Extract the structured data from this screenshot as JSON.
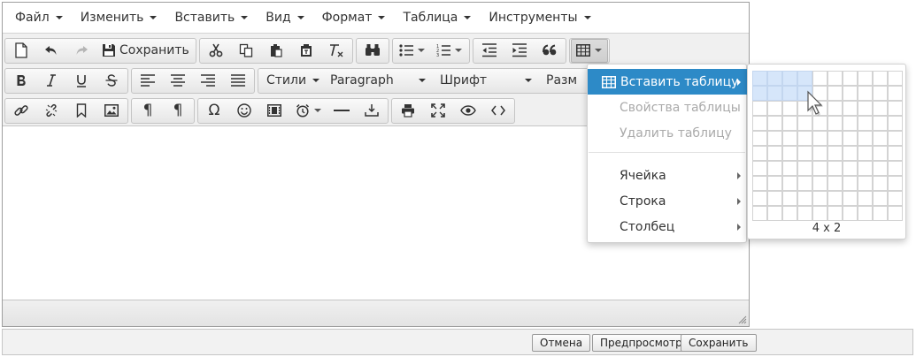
{
  "menubar": {
    "items": [
      {
        "label": "Файл"
      },
      {
        "label": "Изменить"
      },
      {
        "label": "Вставить"
      },
      {
        "label": "Вид"
      },
      {
        "label": "Формат"
      },
      {
        "label": "Таблица"
      },
      {
        "label": "Инструменты"
      }
    ]
  },
  "toolbar": {
    "save_label": "Сохранить",
    "styles_label": "Стили",
    "paragraph_label": "Paragraph",
    "font_label": "Шрифт",
    "size_label": "Разм"
  },
  "table_menu": {
    "insert_table": "Вставить таблицу",
    "table_properties": "Свойства таблицы",
    "delete_table": "Удалить таблицу",
    "cell": "Ячейка",
    "row": "Строка",
    "column": "Столбец"
  },
  "table_grid": {
    "columns": 10,
    "rows": 10,
    "selected_cols": 4,
    "selected_rows": 2,
    "size_label": "4 x 2"
  },
  "footer": {
    "cancel_label": "Отмена",
    "preview_label": "Предпросмотр",
    "save_label": "Сохранить"
  },
  "colors": {
    "highlight": "#2d8ac7",
    "grid_selected": "#d6e6fa"
  }
}
